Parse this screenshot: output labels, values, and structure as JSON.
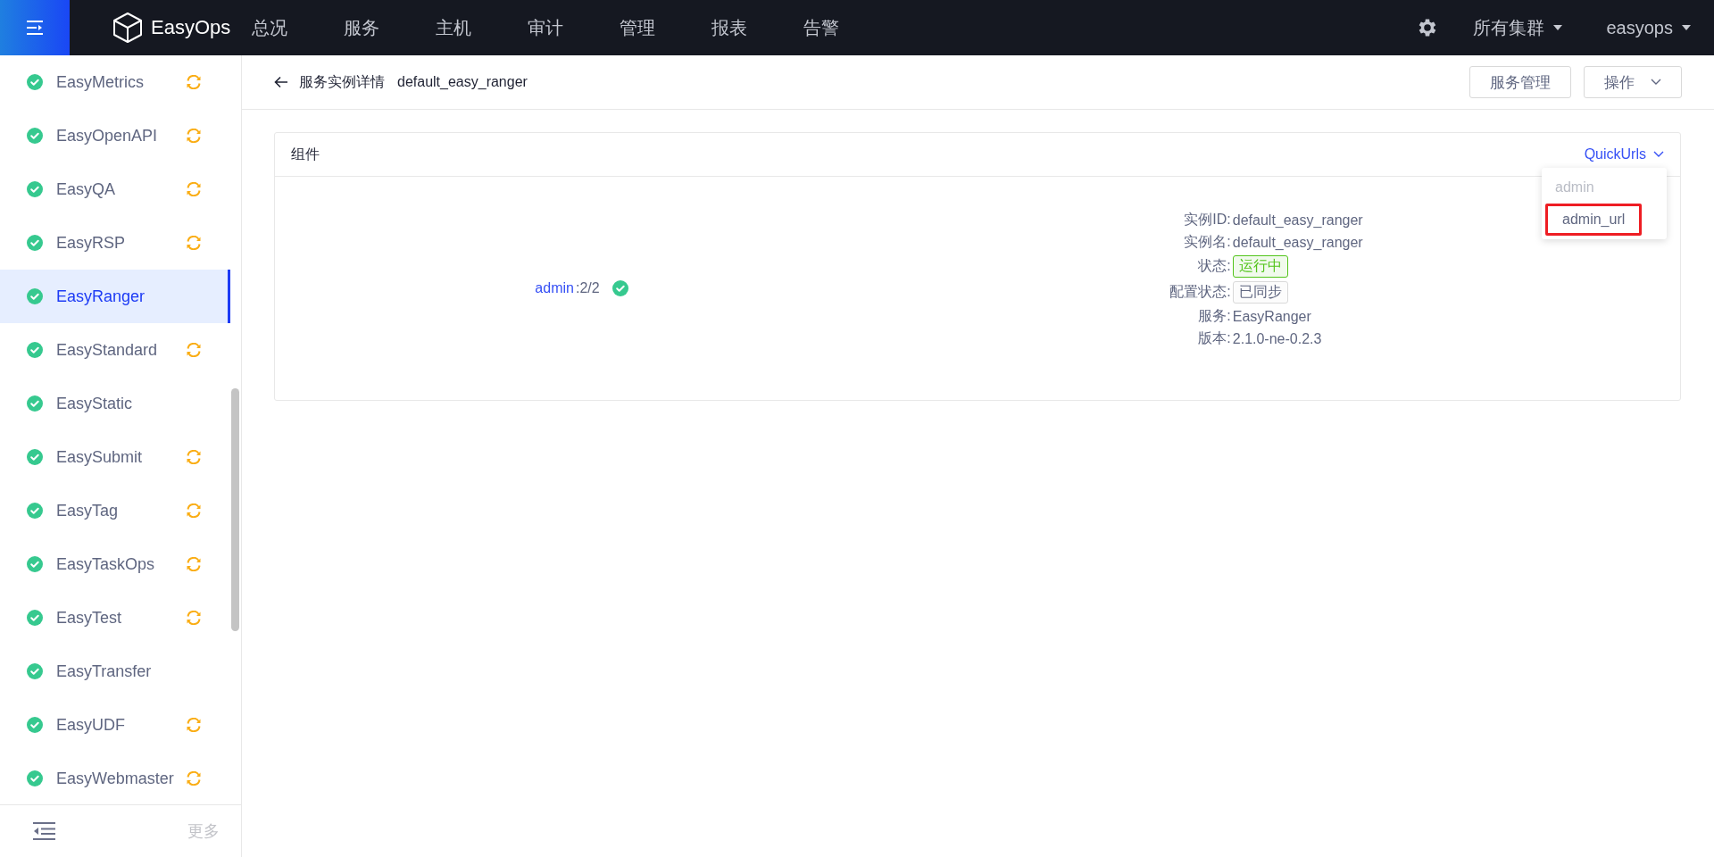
{
  "topbar": {
    "brand": "EasyOps",
    "nav": [
      {
        "label": "总况"
      },
      {
        "label": "服务"
      },
      {
        "label": "主机"
      },
      {
        "label": "审计"
      },
      {
        "label": "管理"
      },
      {
        "label": "报表"
      },
      {
        "label": "告警"
      }
    ],
    "cluster_menu": "所有集群",
    "user_menu": "easyops"
  },
  "sidebar": {
    "items": [
      {
        "name": "EasyMetrics",
        "healthy": true,
        "syncing": true,
        "selected": false
      },
      {
        "name": "EasyOpenAPI",
        "healthy": true,
        "syncing": true,
        "selected": false
      },
      {
        "name": "EasyQA",
        "healthy": true,
        "syncing": true,
        "selected": false
      },
      {
        "name": "EasyRSP",
        "healthy": true,
        "syncing": true,
        "selected": false
      },
      {
        "name": "EasyRanger",
        "healthy": true,
        "syncing": false,
        "selected": true
      },
      {
        "name": "EasyStandard",
        "healthy": true,
        "syncing": true,
        "selected": false
      },
      {
        "name": "EasyStatic",
        "healthy": true,
        "syncing": false,
        "selected": false
      },
      {
        "name": "EasySubmit",
        "healthy": true,
        "syncing": true,
        "selected": false
      },
      {
        "name": "EasyTag",
        "healthy": true,
        "syncing": true,
        "selected": false
      },
      {
        "name": "EasyTaskOps",
        "healthy": true,
        "syncing": true,
        "selected": false
      },
      {
        "name": "EasyTest",
        "healthy": true,
        "syncing": true,
        "selected": false
      },
      {
        "name": "EasyTransfer",
        "healthy": true,
        "syncing": false,
        "selected": false
      },
      {
        "name": "EasyUDF",
        "healthy": true,
        "syncing": true,
        "selected": false
      },
      {
        "name": "EasyWebmaster",
        "healthy": true,
        "syncing": true,
        "selected": false
      }
    ],
    "more": "更多"
  },
  "header": {
    "title": "服务实例详情",
    "instance": "default_easy_ranger",
    "buttons": [
      {
        "label": "服务管理",
        "kind": "plain"
      },
      {
        "label": "操作",
        "kind": "dropdown"
      }
    ]
  },
  "card": {
    "title": "组件",
    "quick_urls": {
      "label": "QuickUrls",
      "expanded": true,
      "items": [
        {
          "label": "admin",
          "disabled": true,
          "highlighted": false
        },
        {
          "label": "admin_url",
          "disabled": false,
          "highlighted": true
        }
      ]
    },
    "component": {
      "name": "admin",
      "count": ":2/2",
      "healthy": true
    },
    "details": [
      {
        "label": "实例ID:",
        "value": "default_easy_ranger",
        "kind": "text"
      },
      {
        "label": "实例名:",
        "value": "default_easy_ranger",
        "kind": "text"
      },
      {
        "label": "状态:",
        "value": "运行中",
        "kind": "tag",
        "color": "#52c41a"
      },
      {
        "label": "配置状态:",
        "value": "已同步",
        "kind": "tag",
        "color": "#d9d9d9"
      },
      {
        "label": "服务:",
        "value": "EasyRanger",
        "kind": "text"
      },
      {
        "label": "版本:",
        "value": "2.1.0-ne-0.2.3",
        "kind": "text"
      }
    ]
  }
}
